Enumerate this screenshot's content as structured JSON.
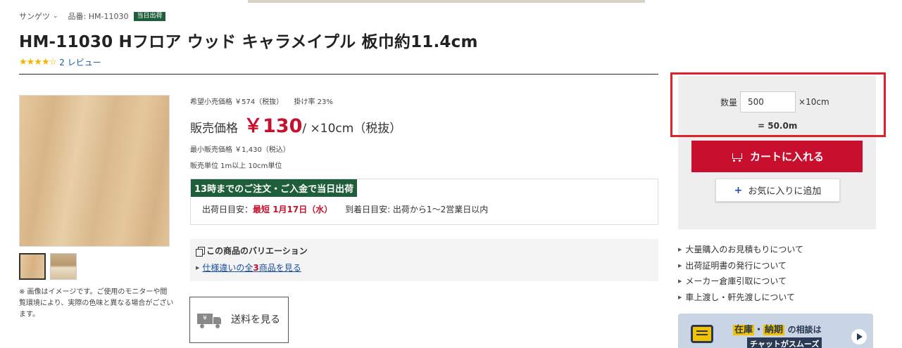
{
  "breadcrumb": {
    "brand": "サンゲツ",
    "product_code": "品番: HM-11030",
    "same_day_badge": "当日出荷"
  },
  "product": {
    "title": "HM-11030 Hフロア ウッド キャラメイプル 板巾約11.4cm",
    "rating": 4.5,
    "stars": "★★★★☆",
    "review_link": "2 レビュー"
  },
  "gallery": {
    "note": "※ 画像はイメージです。ご使用のモニターや閲覧環境により、実際の色味と異なる場合がございます。"
  },
  "price": {
    "retail": "希望小売価格 ￥574（税抜）",
    "rate": "掛け率 23%",
    "label": "販売価格",
    "value": "￥130",
    "unit": "/ ×10cm（税抜）",
    "min_price": "最小販売価格 ￥1,430（税込）",
    "sale_unit": "販売単位 1m以上 10cm単位"
  },
  "shipping": {
    "headline": "13時までのご注文・ご入金で当日出荷",
    "ship_date_label": "出荷日目安：",
    "ship_date_value": "最短 1月17日（水）",
    "arrival": "到着日目安: 出荷から1〜2営業日以内"
  },
  "variation": {
    "title": "この商品のバリエーション",
    "link_pre": "仕様違いの全",
    "link_num": "3",
    "link_post": "商品を見る"
  },
  "shipping_fee_button": {
    "label": "送料を見る",
    "truck_mark": "¥"
  },
  "cart": {
    "qty_label": "数量",
    "qty_value": "500",
    "qty_unit": "×10cm",
    "total": "= 50.0m",
    "add_to_cart": "カートに入れる",
    "add_favorite": "お気に入りに追加"
  },
  "links": [
    "大量購入のお見積もりについて",
    "出荷証明書の発行について",
    "メーカー倉庫引取について",
    "車上渡し・軒先渡しについて"
  ],
  "chat_banner": {
    "zaiko": "在庫",
    "dot": "・",
    "nouki": "納期",
    "rest": "の相談は",
    "sub": "チャットがスムーズ"
  },
  "colors": {
    "accent_red": "#c8102e",
    "badge_green": "#1f5e3a",
    "link_blue": "#1a4fa0",
    "highlight_red": "#e0202a"
  }
}
